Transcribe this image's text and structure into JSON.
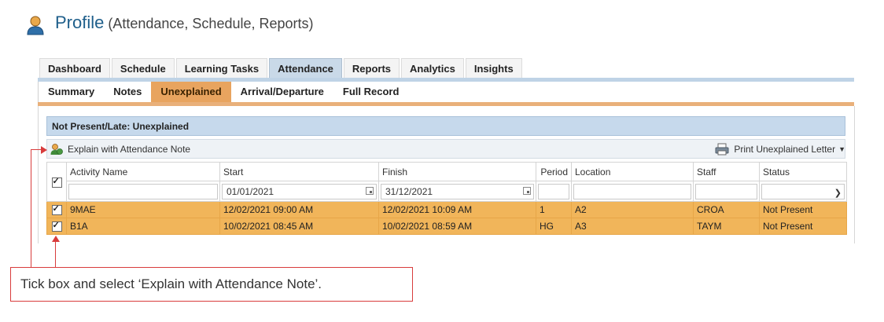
{
  "header": {
    "title": "Profile",
    "subtitle": " (Attendance, Schedule, Reports)"
  },
  "main_tabs": [
    {
      "label": "Dashboard"
    },
    {
      "label": "Schedule"
    },
    {
      "label": "Learning Tasks"
    },
    {
      "label": "Attendance",
      "active": true
    },
    {
      "label": "Reports"
    },
    {
      "label": "Analytics"
    },
    {
      "label": "Insights"
    }
  ],
  "sub_tabs": [
    {
      "label": "Summary"
    },
    {
      "label": "Notes"
    },
    {
      "label": "Unexplained",
      "active": true
    },
    {
      "label": "Arrival/Departure"
    },
    {
      "label": "Full Record"
    }
  ],
  "panel": {
    "title": "Not Present/Late: Unexplained",
    "explain_label": "Explain with Attendance Note",
    "print_label": "Print Unexplained Letter"
  },
  "grid": {
    "columns": [
      "Activity Name",
      "Start",
      "Finish",
      "Period",
      "Location",
      "Staff",
      "Status"
    ],
    "filters": {
      "start": "01/01/2021",
      "finish": "31/12/2021"
    },
    "rows": [
      {
        "activity": "9MAE",
        "start": "12/02/2021 09:00 AM",
        "finish": "12/02/2021 10:09 AM",
        "period": "1",
        "location": "A2",
        "staff": "CROA",
        "status": "Not Present"
      },
      {
        "activity": "B1A",
        "start": "10/02/2021 08:45 AM",
        "finish": "10/02/2021 08:59 AM",
        "period": "HG",
        "location": "A3",
        "staff": "TAYM",
        "status": "Not Present"
      }
    ]
  },
  "annotation": {
    "text": "Tick box and select ‘Explain with Attendance Note’."
  },
  "colors": {
    "accent_blue": "#c6d9ec",
    "accent_orange": "#e8a45f",
    "row_highlight": "#f1b55a",
    "annotation_red": "#d83c3c"
  }
}
